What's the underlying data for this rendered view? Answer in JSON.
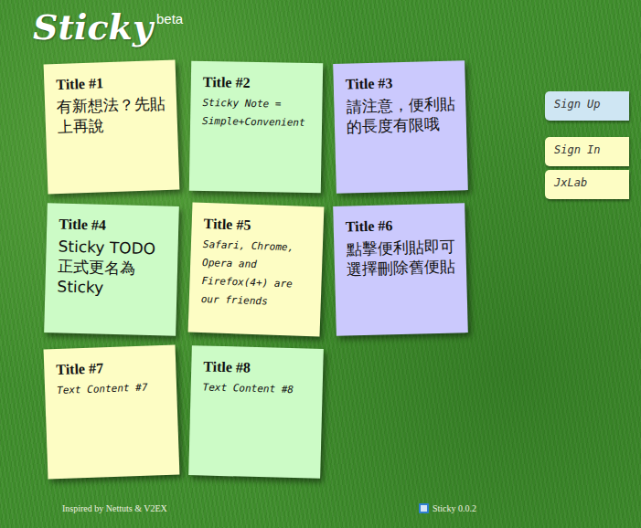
{
  "logo": {
    "text": "Sticky",
    "badge": "beta"
  },
  "notes": [
    {
      "title": "Title #1",
      "content": "有新想法？先貼上再說",
      "color": "#fdfdc4",
      "kind": "big"
    },
    {
      "title": "Title #2",
      "content": "Sticky Note = Simple+Convenient",
      "color": "#ccfbc6",
      "kind": "hand"
    },
    {
      "title": "Title #3",
      "content": "請注意，便利貼的長度有限哦",
      "color": "#cbc9fd",
      "kind": "big"
    },
    {
      "title": "Title #4",
      "content": "Sticky TODO正式更名為Sticky",
      "color": "#ccfbc6",
      "kind": "big"
    },
    {
      "title": "Title #5",
      "content": "Safari, Chrome, Opera and Firefox(4+) are our friends",
      "color": "#fdfdc4",
      "kind": "hand"
    },
    {
      "title": "Title #6",
      "content": "點擊便利貼即可選擇刪除舊便貼",
      "color": "#cbc9fd",
      "kind": "big"
    },
    {
      "title": "Title #7",
      "content": "Text Content #7",
      "color": "#fdfdc4",
      "kind": "hand"
    },
    {
      "title": "Title #8",
      "content": "Text Content #8",
      "color": "#ccfbc6",
      "kind": "hand"
    }
  ],
  "side_buttons": [
    {
      "label": "Sign Up",
      "color": "#cfe6f3"
    },
    {
      "label": "Sign In",
      "color": "#fdfdc4"
    },
    {
      "label": "JxLab",
      "color": "#fdfdc4"
    }
  ],
  "footer": {
    "credit": "Inspired by Nettuts & V2EX",
    "version": "Sticky 0.0.2"
  }
}
